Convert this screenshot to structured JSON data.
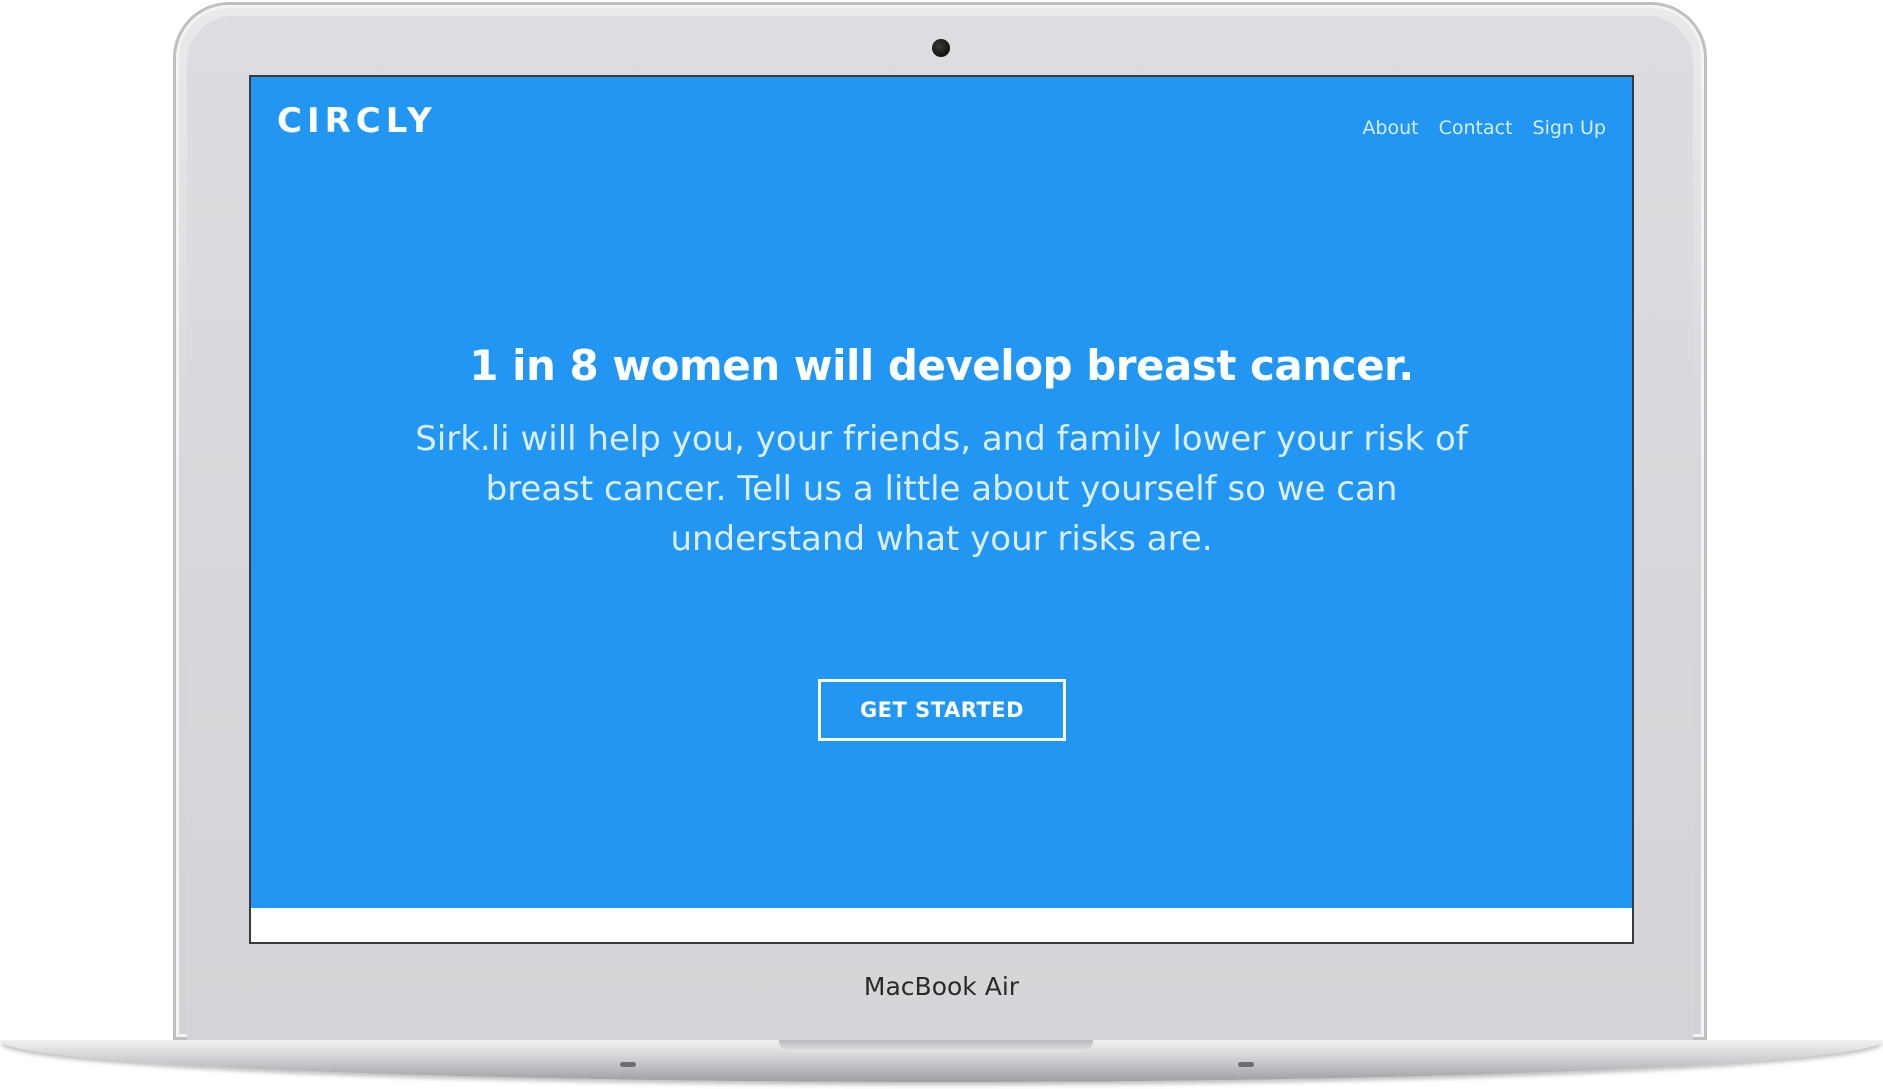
{
  "device": {
    "label": "MacBook Air"
  },
  "site": {
    "logo": "CIRCLY",
    "nav": {
      "about": "About",
      "contact": "Contact",
      "signup": "Sign Up"
    },
    "hero": {
      "headline": "1 in 8 women will develop breast cancer.",
      "subtext": "Sirk.li will help you, your friends, and family lower your risk of breast cancer. Tell us a little about yourself so we can understand what your risks are.",
      "cta": "GET STARTED"
    }
  },
  "colors": {
    "primary": "#2196f3",
    "text": "#ffffff"
  }
}
